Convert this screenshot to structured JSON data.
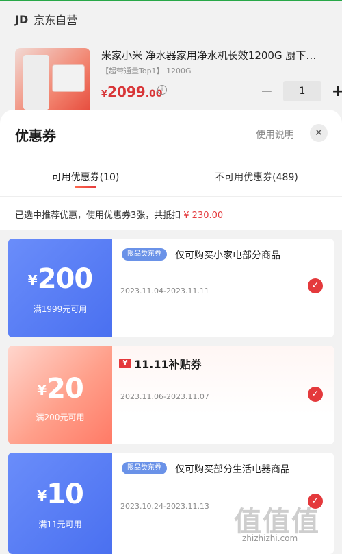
{
  "store": {
    "logo": "JD",
    "name": "京东自营"
  },
  "product": {
    "title": "米家小米 净水器家用净水机长效1200G 厨下…",
    "subtitle": "【超带通量Top1】 1200G",
    "price_symbol": "¥",
    "price_int": "2099",
    "price_dec": ".00",
    "quantity": "1",
    "minus_label": "−",
    "plus_label": "+"
  },
  "sheet": {
    "title": "优惠券",
    "help_label": "使用说明",
    "close_label": "✕",
    "tabs": [
      {
        "label": "可用优惠券(10)"
      },
      {
        "label": "不可用优惠券(489)"
      }
    ],
    "summary_text": "已选中推荐优惠，使用优惠券3张，共抵扣",
    "summary_amount": "¥ 230.00"
  },
  "coupons": [
    {
      "currency": "¥",
      "amount": "200",
      "condition": "满1999元可用",
      "tag": "限品类东券",
      "description": "仅可购买小家电部分商品",
      "dates": "2023.11.04-2023.11.11",
      "selected": true,
      "style": "blue"
    },
    {
      "currency": "¥",
      "amount": "20",
      "condition": "满200元可用",
      "badge_icon": "¥",
      "badge_text": "11.11补贴券",
      "dates": "2023.11.06-2023.11.07",
      "selected": true,
      "style": "pink"
    },
    {
      "currency": "¥",
      "amount": "10",
      "condition": "满11元可用",
      "tag": "限品类东券",
      "description": "仅可购买部分生活电器商品",
      "dates": "2023.10.24-2023.11.13",
      "selected": true,
      "style": "blue"
    }
  ],
  "watermark": {
    "text": "值值值",
    "url": "zhizhizhi.com"
  },
  "colors": {
    "accent": "#e4393c",
    "coupon_blue": "#4a70f0",
    "coupon_pink": "#ff9f8a",
    "tag_blue": "#6a92e8"
  }
}
